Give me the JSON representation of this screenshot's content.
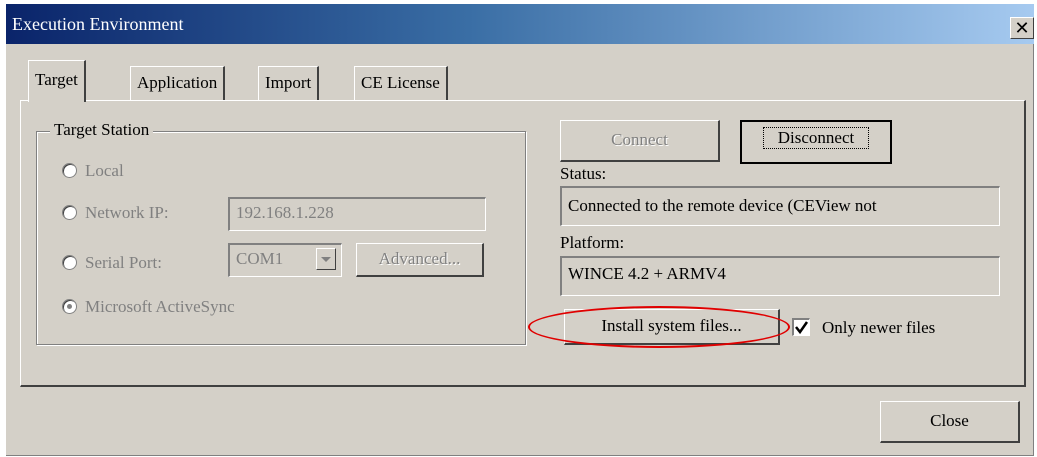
{
  "window": {
    "title": "Execution Environment"
  },
  "tabs": [
    {
      "label": "Target",
      "active": true
    },
    {
      "label": "Application",
      "active": false
    },
    {
      "label": "Import",
      "active": false
    },
    {
      "label": "CE License",
      "active": false
    }
  ],
  "target_station": {
    "title": "Target Station",
    "options": {
      "local": "Local",
      "network_ip": "Network IP:",
      "serial_port": "Serial Port:",
      "activesync": "Microsoft ActiveSync"
    },
    "selected": "Microsoft ActiveSync",
    "ip_value": "192.168.1.228",
    "com_value": "COM1",
    "advanced_label": "Advanced..."
  },
  "connection": {
    "connect_label": "Connect",
    "disconnect_label": "Disconnect",
    "status_label": "Status:",
    "status_value": "Connected to the remote device (CEView not",
    "platform_label": "Platform:",
    "platform_value": "WINCE 4.2 + ARMV4",
    "install_label": "Install system files...",
    "only_newer_label": "Only newer files",
    "only_newer_checked": true
  },
  "footer": {
    "close_label": "Close"
  },
  "colors": {
    "annotation": "#e00000",
    "title_start": "#0a246a",
    "title_end": "#a6caf0"
  }
}
